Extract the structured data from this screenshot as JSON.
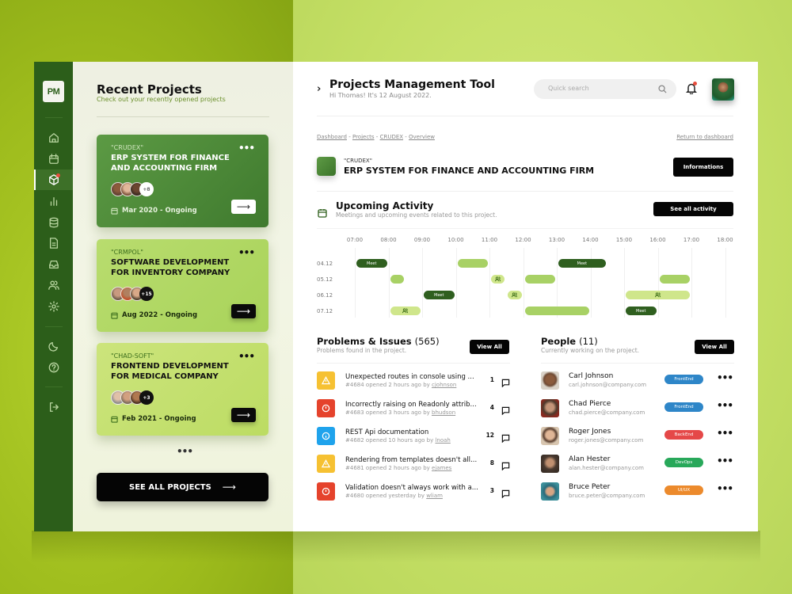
{
  "app": {
    "logo": "PM",
    "title": "Projects Management Tool",
    "greeting": "Hi Thomas! It's 12 August 2022."
  },
  "sidebar": {
    "items": [
      {
        "icon": "home-icon",
        "label": "Home",
        "active": false
      },
      {
        "icon": "calendar-icon",
        "label": "Calendar",
        "active": false
      },
      {
        "icon": "box-icon",
        "label": "Projects",
        "active": true,
        "notification": true
      },
      {
        "icon": "bar-chart-icon",
        "label": "Analytics",
        "active": false
      },
      {
        "icon": "database-icon",
        "label": "Database",
        "active": false
      },
      {
        "icon": "document-icon",
        "label": "Documents",
        "active": false
      },
      {
        "icon": "inbox-icon",
        "label": "Inbox",
        "active": false
      },
      {
        "icon": "users-icon",
        "label": "Users",
        "active": false
      },
      {
        "icon": "gear-icon",
        "label": "Settings",
        "active": false
      }
    ],
    "bottom": [
      {
        "icon": "moon-icon",
        "label": "Dark mode"
      },
      {
        "icon": "help-icon",
        "label": "Help"
      },
      {
        "icon": "logout-icon",
        "label": "Log out"
      }
    ]
  },
  "recent": {
    "title": "Recent Projects",
    "subtitle": "Check out your recently opened projects",
    "more_indicator": "•••",
    "see_all_label": "SEE ALL PROJECTS",
    "see_all_arrow": "⟶",
    "cards": [
      {
        "code": "\"CRUDEX\"",
        "title": "ERP SYSTEM FOR FINANCE AND ACCOUNTING FIRM",
        "extra_members": "+8",
        "date": "Mar 2020 - Ongoing",
        "more": "•••",
        "arrow": "⟶"
      },
      {
        "code": "\"CRMPOL\"",
        "title": "SOFTWARE DEVELOPMENT FOR INVENTORY COMPANY",
        "extra_members": "+15",
        "date": "Aug 2022 - Ongoing",
        "more": "•••",
        "arrow": "⟶"
      },
      {
        "code": "\"CHAD-SOFT\"",
        "title": "FRONTEND DEVELOPMENT FOR MEDICAL COMPANY",
        "extra_members": "+3",
        "date": "Feb 2021 - Ongoing",
        "more": "•••",
        "arrow": "⟶"
      }
    ]
  },
  "header": {
    "search_placeholder": "Quick search",
    "chevron": "›",
    "notifications": true
  },
  "breadcrumb": {
    "items": [
      "Dashboard",
      "Projects",
      "CRUDEX",
      "Overview"
    ],
    "separator": " - ",
    "return_label": "Return to dashboard"
  },
  "project": {
    "code": "\"CRUDEX\"",
    "title": "ERP SYSTEM FOR FINANCE AND ACCOUNTING FIRM",
    "info_button": "Informations"
  },
  "activity": {
    "title": "Upcoming Activity",
    "subtitle": "Meetings and upcoming events related to this project.",
    "button": "See all activity",
    "hours": [
      "07:00",
      "08:00",
      "09:00",
      "10:00",
      "11:00",
      "12:00",
      "13:00",
      "14:00",
      "15:00",
      "16:00",
      "17:00",
      "18:00"
    ],
    "days": [
      "04.12",
      "05.12",
      "06.12",
      "07.12"
    ],
    "events": [
      {
        "day": 0,
        "start": 7.0,
        "end": 8.0,
        "type": "dark",
        "label": "Meet"
      },
      {
        "day": 0,
        "start": 10.0,
        "end": 11.0,
        "type": "medium",
        "label": ""
      },
      {
        "day": 0,
        "start": 13.0,
        "end": 14.5,
        "type": "dark",
        "label": "Meet"
      },
      {
        "day": 1,
        "start": 8.0,
        "end": 8.5,
        "type": "medium",
        "label": ""
      },
      {
        "day": 1,
        "start": 11.0,
        "end": 11.5,
        "type": "light",
        "label": "",
        "icon": "people"
      },
      {
        "day": 1,
        "start": 12.0,
        "end": 13.0,
        "type": "medium",
        "label": ""
      },
      {
        "day": 1,
        "start": 16.0,
        "end": 17.0,
        "type": "medium",
        "label": ""
      },
      {
        "day": 2,
        "start": 9.0,
        "end": 10.0,
        "type": "dark",
        "label": "Meet"
      },
      {
        "day": 2,
        "start": 11.5,
        "end": 12.0,
        "type": "light",
        "label": "",
        "icon": "people"
      },
      {
        "day": 2,
        "start": 15.0,
        "end": 17.0,
        "type": "light",
        "label": "",
        "icon": "people"
      },
      {
        "day": 3,
        "start": 8.0,
        "end": 9.0,
        "type": "light",
        "label": "",
        "icon": "people"
      },
      {
        "day": 3,
        "start": 12.0,
        "end": 14.0,
        "type": "medium",
        "label": ""
      },
      {
        "day": 3,
        "start": 15.0,
        "end": 16.0,
        "type": "dark",
        "label": "Meet"
      }
    ]
  },
  "problems": {
    "title": "Problems & Issues",
    "count": "(565)",
    "subtitle": "Problems found in the project.",
    "button": "View All",
    "items": [
      {
        "type": "warning",
        "title": "Unexpected routes in console using ...",
        "id": "#4684",
        "opened": "opened 2 hours ago by",
        "author": "cjohnson",
        "comments": "1"
      },
      {
        "type": "error",
        "title": "Incorrectly raising on Readonly attrib...",
        "id": "#4683",
        "opened": "opened 3 hours ago by",
        "author": "bhudson",
        "comments": "4"
      },
      {
        "type": "info",
        "title": "REST Api documentation",
        "id": "#4682",
        "opened": "opened 10 hours ago by",
        "author": "lnoah",
        "comments": "12"
      },
      {
        "type": "warning",
        "title": "Rendering from templates doesn't all...",
        "id": "#4681",
        "opened": "opened 2 hours ago by",
        "author": "ejames",
        "comments": "8"
      },
      {
        "type": "error",
        "title": "Validation doesn't always work with a...",
        "id": "#4680",
        "opened": "opened yesterday by",
        "author": "wliam",
        "comments": "3"
      }
    ]
  },
  "people": {
    "title": "People",
    "count": "(11)",
    "subtitle": "Currently working on the project.",
    "button": "View All",
    "more": "•••",
    "items": [
      {
        "name": "Carl Johnson",
        "email": "carl.johnson@company.com",
        "role": "FrontEnd",
        "color": "#2e86c8"
      },
      {
        "name": "Chad Pierce",
        "email": "chad.pierce@company.com",
        "role": "FrontEnd",
        "color": "#2e86c8"
      },
      {
        "name": "Roger Jones",
        "email": "roger.jones@company.com",
        "role": "BackEnd",
        "color": "#e54848"
      },
      {
        "name": "Alan Hester",
        "email": "alan.hester@company.com",
        "role": "DevOps",
        "color": "#28a85a"
      },
      {
        "name": "Bruce Peter",
        "email": "bruce.peter@company.com",
        "role": "UI/UX",
        "color": "#ec8a2c"
      }
    ]
  },
  "colors": {
    "brand_dark_green": "#2c5e1a",
    "accent_lime": "#a8d165",
    "warning": "#f6c132",
    "error": "#e5432c",
    "info": "#1fa3ec"
  }
}
